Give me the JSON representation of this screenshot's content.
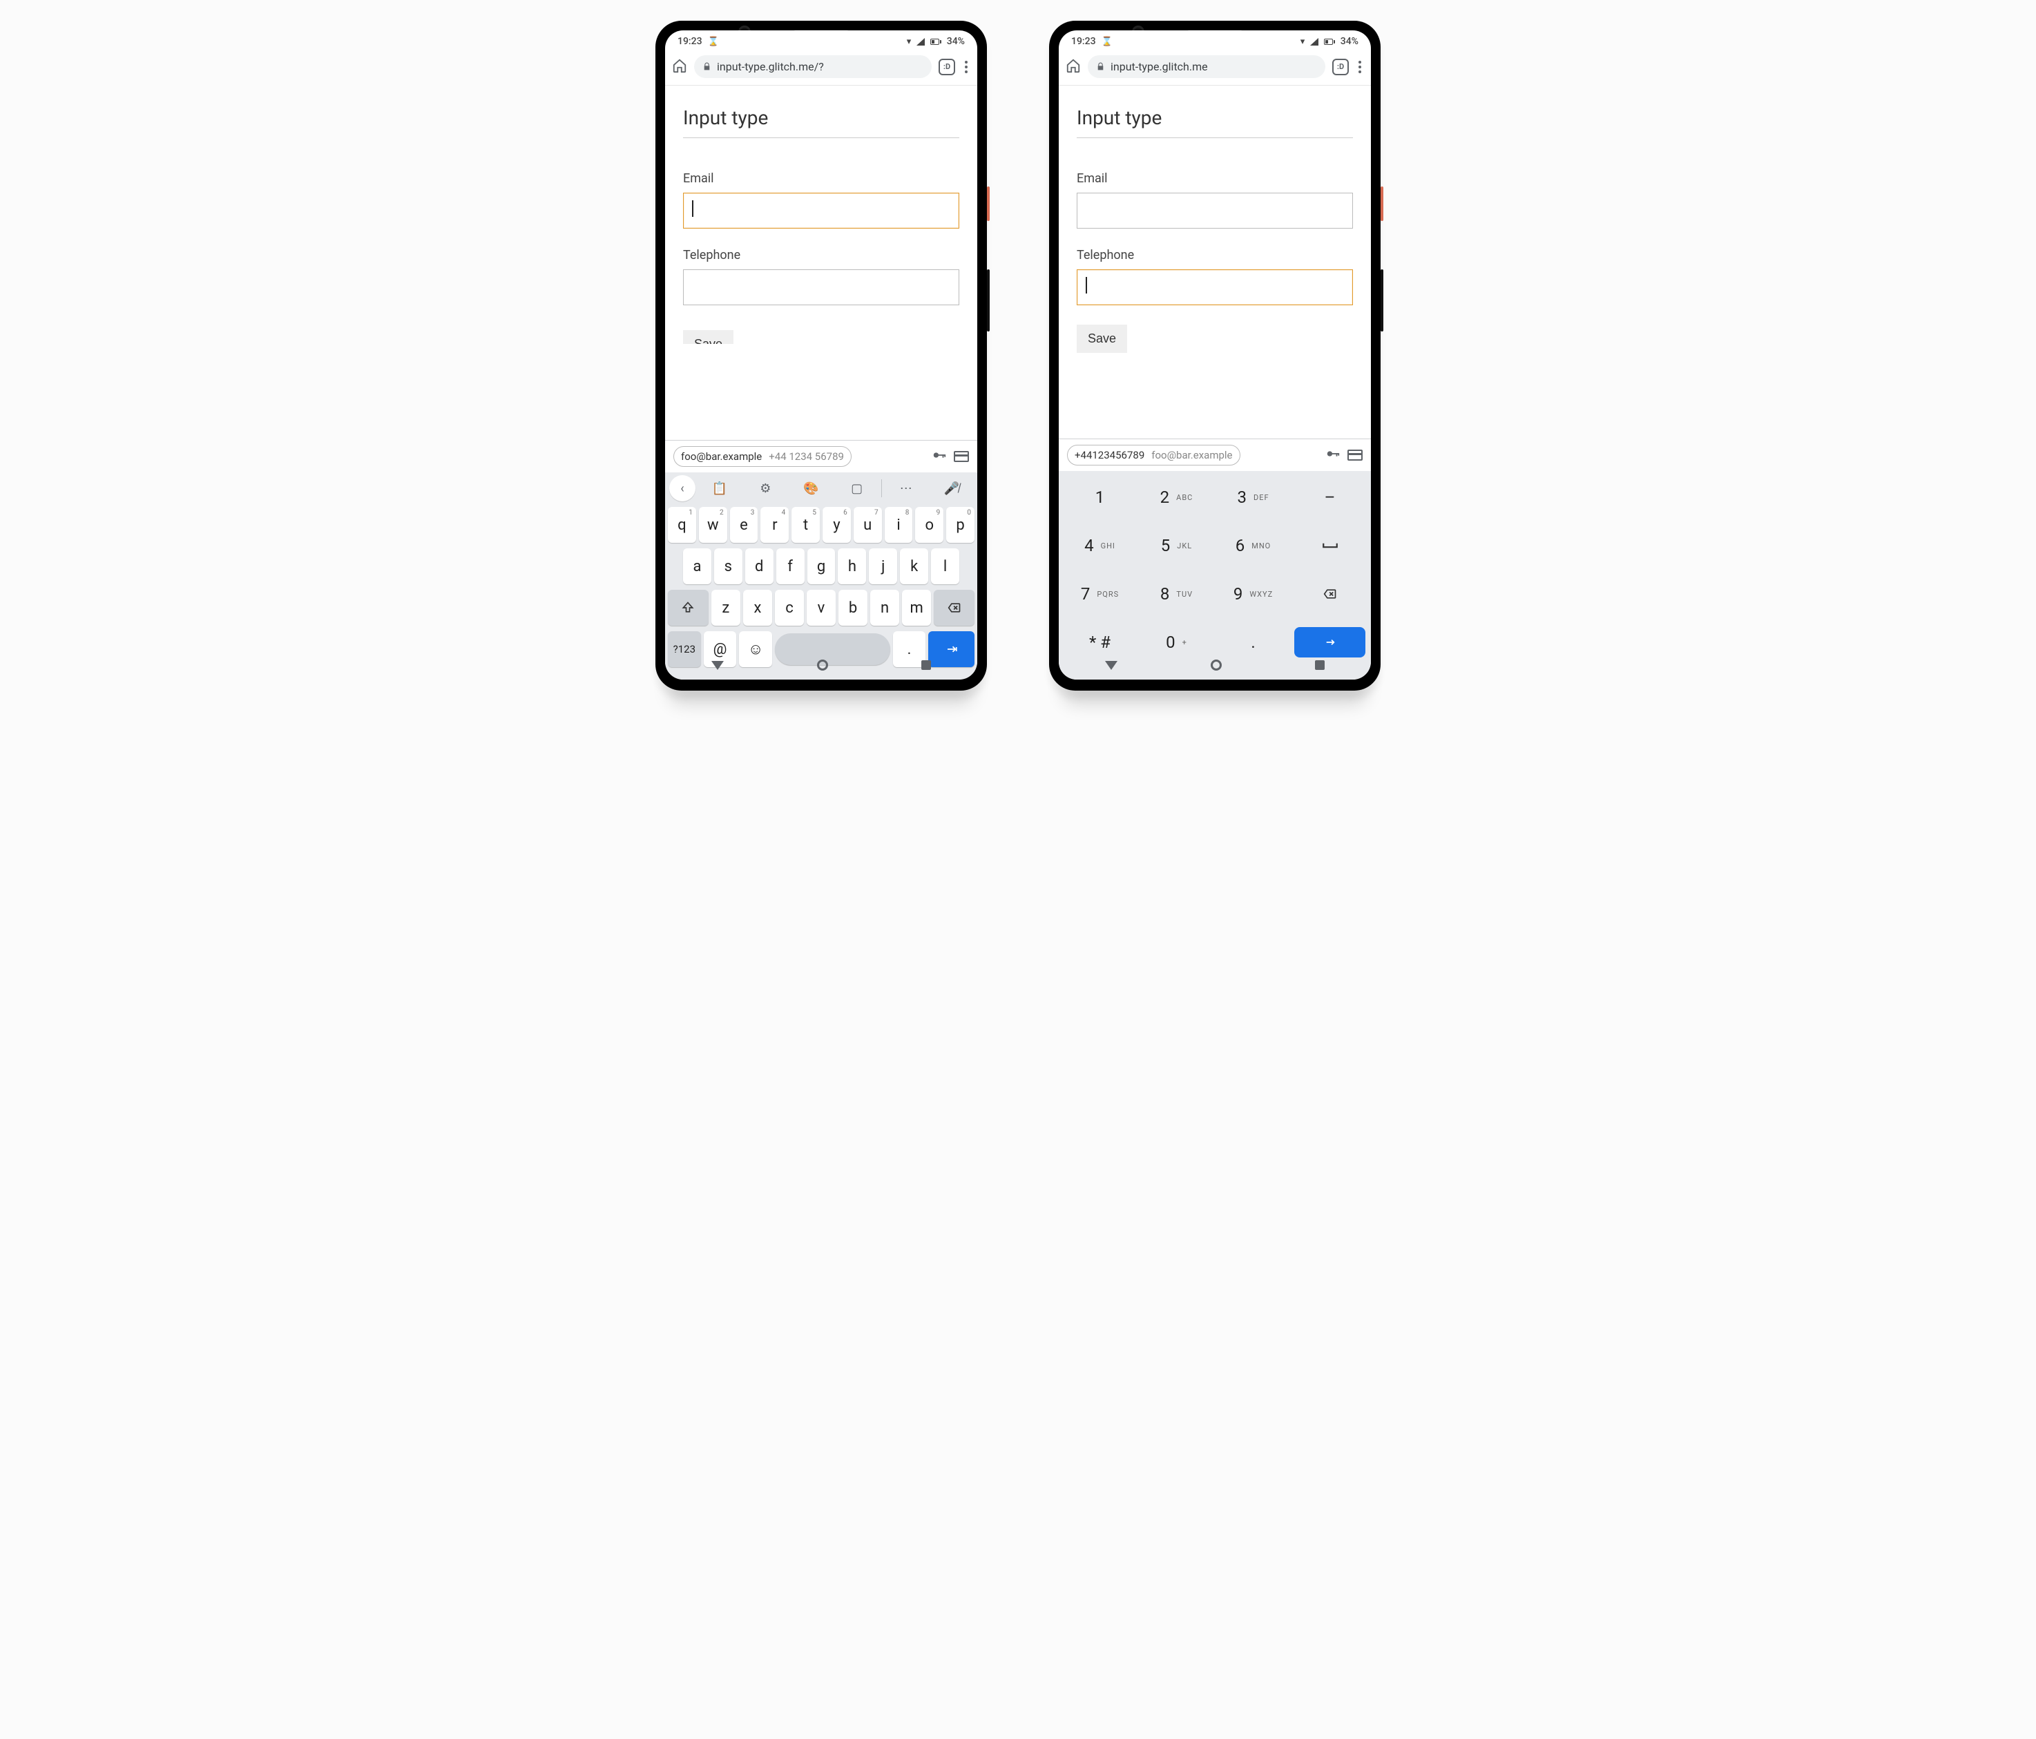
{
  "status": {
    "time": "19:23",
    "battery": "34%"
  },
  "left": {
    "url": "input-type.glitch.me/?",
    "tab_count": ":D",
    "page": {
      "heading": "Input type",
      "email_label": "Email",
      "tel_label": "Telephone",
      "focused_field": "email",
      "save_label": "Save"
    },
    "suggestion": {
      "email": "foo@bar.example",
      "phone": "+44 1234 56789"
    },
    "qwerty": {
      "row1": [
        [
          "q",
          "1"
        ],
        [
          "w",
          "2"
        ],
        [
          "e",
          "3"
        ],
        [
          "r",
          "4"
        ],
        [
          "t",
          "5"
        ],
        [
          "y",
          "6"
        ],
        [
          "u",
          "7"
        ],
        [
          "i",
          "8"
        ],
        [
          "o",
          "9"
        ],
        [
          "p",
          "0"
        ]
      ],
      "row2": [
        "a",
        "s",
        "d",
        "f",
        "g",
        "h",
        "j",
        "k",
        "l"
      ],
      "row3": [
        "z",
        "x",
        "c",
        "v",
        "b",
        "n",
        "m"
      ],
      "sym_key": "?123",
      "at_key": "@",
      "period_key": "."
    }
  },
  "right": {
    "url": "input-type.glitch.me",
    "tab_count": ":D",
    "page": {
      "heading": "Input type",
      "email_label": "Email",
      "tel_label": "Telephone",
      "focused_field": "tel",
      "save_label": "Save"
    },
    "suggestion": {
      "phone": "+44123456789",
      "email": "foo@bar.example"
    },
    "numpad": {
      "rows": [
        [
          [
            "1",
            ""
          ],
          [
            "2",
            "ABC"
          ],
          [
            "3",
            "DEF"
          ],
          [
            "–",
            ""
          ]
        ],
        [
          [
            "4",
            "GHI"
          ],
          [
            "5",
            "JKL"
          ],
          [
            "6",
            "MNO"
          ],
          [
            "␣",
            ""
          ]
        ],
        [
          [
            "7",
            "PQRS"
          ],
          [
            "8",
            "TUV"
          ],
          [
            "9",
            "WXYZ"
          ],
          [
            "⌫",
            ""
          ]
        ],
        [
          [
            "* #",
            ""
          ],
          [
            "0",
            "+"
          ],
          [
            ".",
            ""
          ],
          [
            "→",
            ""
          ]
        ]
      ]
    }
  }
}
